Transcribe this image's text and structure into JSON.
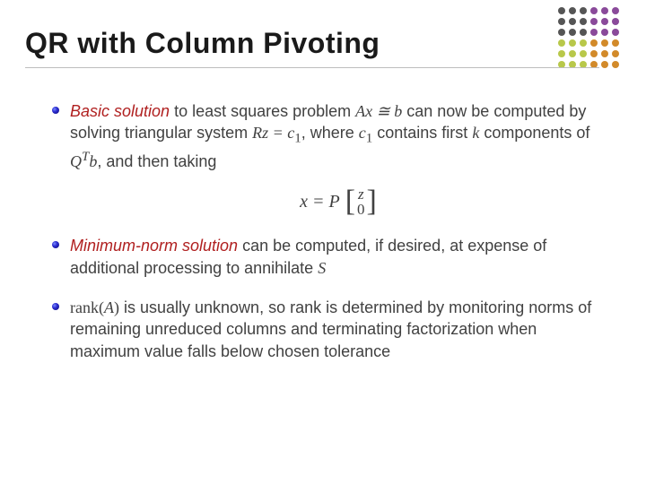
{
  "title": "QR with Column Pivoting",
  "dots": {
    "colors": [
      [
        "#555555",
        "#555555",
        "#555555",
        "#8a4a9a",
        "#8a4a9a",
        "#8a4a9a"
      ],
      [
        "#555555",
        "#555555",
        "#555555",
        "#8a4a9a",
        "#8a4a9a",
        "#8a4a9a"
      ],
      [
        "#555555",
        "#555555",
        "#555555",
        "#8a4a9a",
        "#8a4a9a",
        "#8a4a9a"
      ],
      [
        "#b8c84a",
        "#b8c84a",
        "#b8c84a",
        "#d28a2a",
        "#d28a2a",
        "#d28a2a"
      ],
      [
        "#b8c84a",
        "#b8c84a",
        "#b8c84a",
        "#d28a2a",
        "#d28a2a",
        "#d28a2a"
      ],
      [
        "#b8c84a",
        "#b8c84a",
        "#b8c84a",
        "#d28a2a",
        "#d28a2a",
        "#d28a2a"
      ]
    ]
  },
  "bullets": [
    {
      "term": "Basic solution",
      "t1": " to least squares problem ",
      "m1": "Ax ≅ b",
      "t2": " can now be computed by solving triangular system ",
      "m2": "Rz = c",
      "sub2": "1",
      "t3": ", where ",
      "m3": "c",
      "sub3": "1",
      "t4": " contains first ",
      "m4": "k",
      "t5": " components of ",
      "m5a": "Q",
      "m5sup": "T",
      "m5b": "b",
      "t6": ", and then taking"
    },
    {
      "term": "Minimum-norm solution",
      "t1": " can be computed, if desired, at expense of additional processing to annihilate ",
      "m1": "S"
    },
    {
      "m0": "rank(A)",
      "t1": " is usually unknown, so rank is determined by monitoring norms of remaining unreduced columns and terminating factorization when maximum value falls below chosen tolerance"
    }
  ],
  "equation": {
    "lhs": "x = P",
    "vec_top": "z",
    "vec_bot": "0"
  }
}
